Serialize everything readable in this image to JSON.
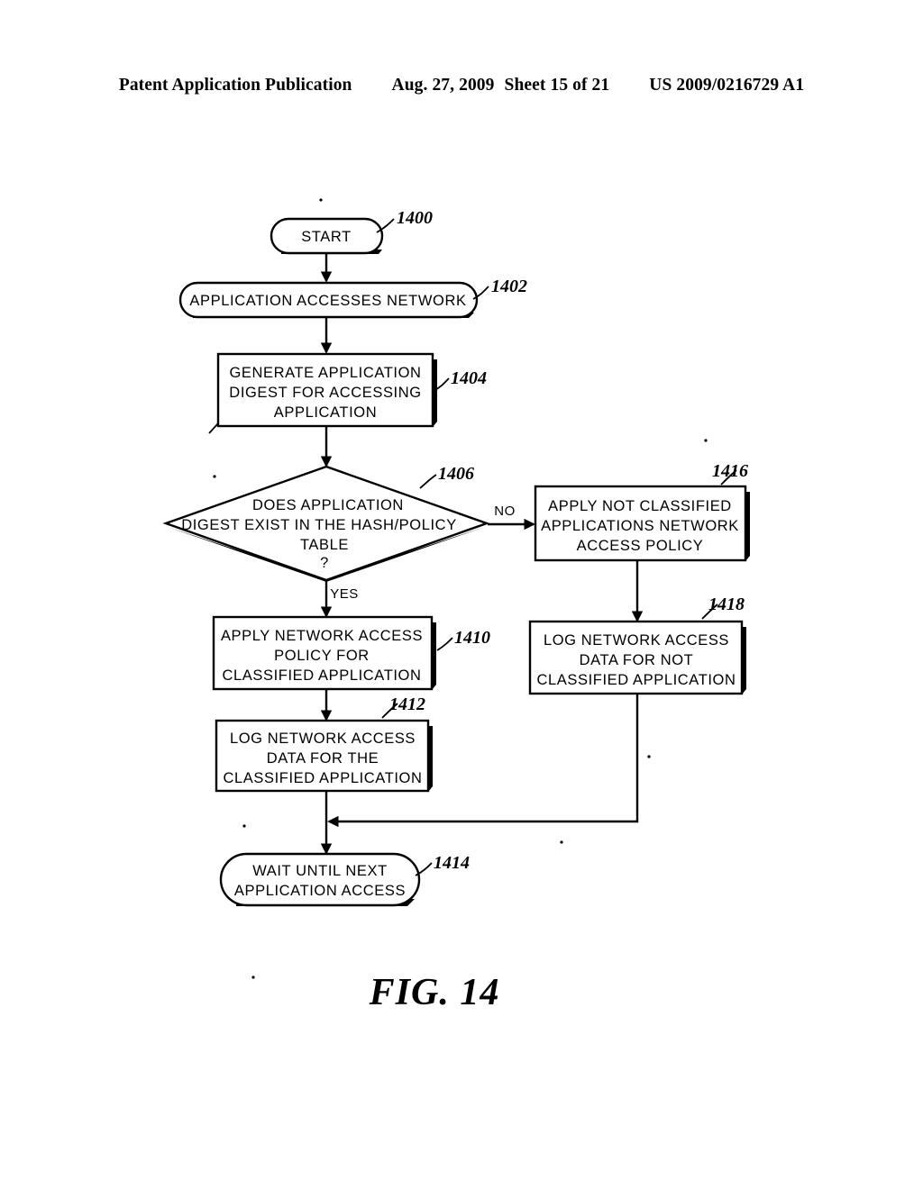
{
  "header": {
    "publication": "Patent Application Publication",
    "date": "Aug. 27, 2009",
    "sheet": "Sheet 15 of 21",
    "patent_number": "US 2009/0216729 A1"
  },
  "figure": {
    "caption": "FIG. 14",
    "nodes": {
      "start": {
        "ref": "1400",
        "shape": "stadium",
        "lines": [
          "START"
        ]
      },
      "app_access": {
        "ref": "1402",
        "shape": "stadium",
        "lines": [
          "APPLICATION ACCESSES NETWORK"
        ]
      },
      "generate_digest": {
        "ref": "1404",
        "shape": "rect",
        "lines": [
          "GENERATE APPLICATION",
          "DIGEST FOR ACCESSING",
          "APPLICATION"
        ]
      },
      "decision": {
        "ref": "1406",
        "shape": "diamond",
        "lines": [
          "DOES APPLICATION",
          "DIGEST EXIST IN THE HASH/POLICY",
          "TABLE",
          "?"
        ]
      },
      "apply_classified": {
        "ref": "1410",
        "shape": "rect",
        "lines": [
          "APPLY NETWORK ACCESS",
          "POLICY FOR",
          "CLASSIFIED APPLICATION"
        ]
      },
      "log_classified": {
        "ref": "1412",
        "shape": "rect",
        "lines": [
          "LOG NETWORK ACCESS",
          "DATA FOR THE",
          "CLASSIFIED APPLICATION"
        ]
      },
      "wait": {
        "ref": "1414",
        "shape": "stadium",
        "lines": [
          "WAIT UNTIL NEXT",
          "APPLICATION ACCESS"
        ]
      },
      "apply_not_classified": {
        "ref": "1416",
        "shape": "rect",
        "lines": [
          "APPLY NOT CLASSIFIED",
          "APPLICATIONS NETWORK",
          "ACCESS POLICY"
        ]
      },
      "log_not_classified": {
        "ref": "1418",
        "shape": "rect",
        "lines": [
          "LOG NETWORK ACCESS",
          "DATA FOR NOT",
          "CLASSIFIED APPLICATION"
        ]
      }
    },
    "edge_labels": {
      "yes": "YES",
      "no": "NO"
    }
  }
}
